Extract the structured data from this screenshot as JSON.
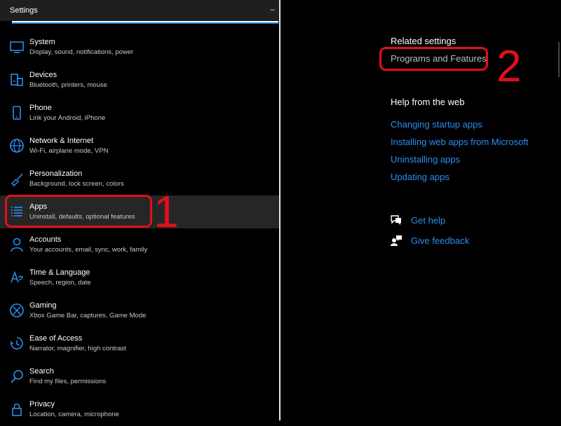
{
  "window": {
    "title": "Settings",
    "minimize_glyph": "–"
  },
  "nav": {
    "items": [
      {
        "icon": "monitor-icon",
        "label": "System",
        "sub": "Display, sound, notifications, power"
      },
      {
        "icon": "devices-icon",
        "label": "Devices",
        "sub": "Bluetooth, printers, mouse"
      },
      {
        "icon": "phone-icon",
        "label": "Phone",
        "sub": "Link your Android, iPhone"
      },
      {
        "icon": "globe-icon",
        "label": "Network & Internet",
        "sub": "Wi-Fi, airplane mode, VPN"
      },
      {
        "icon": "paint-brush-icon",
        "label": "Personalization",
        "sub": "Background, lock screen, colors"
      },
      {
        "icon": "apps-list-icon",
        "label": "Apps",
        "sub": "Uninstall, defaults, optional features"
      },
      {
        "icon": "person-icon",
        "label": "Accounts",
        "sub": "Your accounts, email, sync, work, family"
      },
      {
        "icon": "language-icon",
        "label": "Time & Language",
        "sub": "Speech, region, date"
      },
      {
        "icon": "xbox-icon",
        "label": "Gaming",
        "sub": "Xbox Game Bar, captures, Game Mode"
      },
      {
        "icon": "ease-of-access-icon",
        "label": "Ease of Access",
        "sub": "Narrator, magnifier, high contrast"
      },
      {
        "icon": "search-icon",
        "label": "Search",
        "sub": "Find my files, permissions"
      },
      {
        "icon": "lock-icon",
        "label": "Privacy",
        "sub": "Location, camera, microphone"
      }
    ]
  },
  "callouts": {
    "one": "1",
    "two": "2"
  },
  "related": {
    "heading": "Related settings",
    "programs_link": "Programs and Features"
  },
  "web_help": {
    "heading": "Help from the web",
    "links": [
      "Changing startup apps",
      "Installing web apps from Microsoft",
      "Uninstalling apps",
      "Updating apps"
    ]
  },
  "support": {
    "get_help": "Get help",
    "give_feedback": "Give feedback"
  },
  "colors": {
    "accent": "#2b8ff0",
    "callout": "#e0101a",
    "selected_bg": "#262626"
  }
}
